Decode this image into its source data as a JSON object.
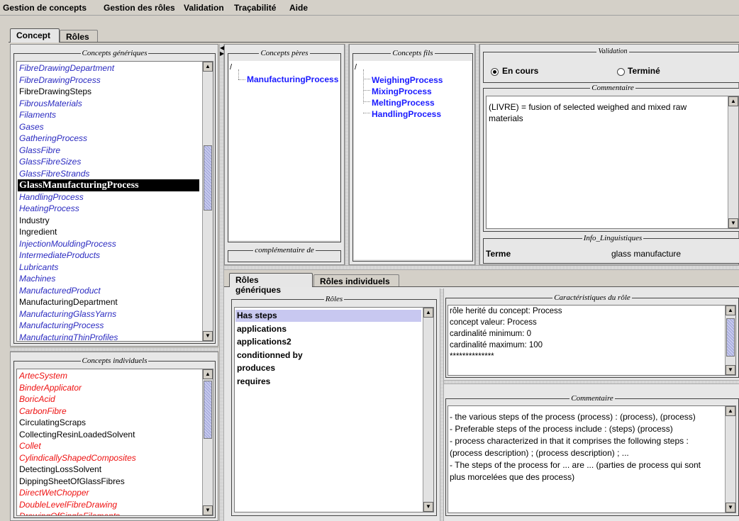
{
  "menu": {
    "items": [
      "Gestion de concepts",
      "Gestion des rôles",
      "Validation",
      "Traçabilité",
      "Aide"
    ]
  },
  "main_tabs": [
    "Concept",
    "Rôles"
  ],
  "generic_concepts": {
    "legend": "Concepts génériques",
    "items": [
      {
        "label": "FibreDrawingDepartment",
        "style": "gen"
      },
      {
        "label": "FibreDrawingProcess",
        "style": "gen"
      },
      {
        "label": "FibreDrawingSteps",
        "style": "blk"
      },
      {
        "label": "FibrousMaterials",
        "style": "gen"
      },
      {
        "label": "Filaments",
        "style": "gen"
      },
      {
        "label": "Gases",
        "style": "gen"
      },
      {
        "label": "GatheringProcess",
        "style": "gen"
      },
      {
        "label": "GlassFibre",
        "style": "gen"
      },
      {
        "label": "GlassFibreSizes",
        "style": "gen"
      },
      {
        "label": "GlassFibreStrands",
        "style": "gen"
      },
      {
        "label": "GlassManufacturingProcess",
        "style": "sel"
      },
      {
        "label": "HandlingProcess",
        "style": "gen"
      },
      {
        "label": "HeatingProcess",
        "style": "gen"
      },
      {
        "label": "Industry",
        "style": "blk"
      },
      {
        "label": "Ingredient",
        "style": "blk"
      },
      {
        "label": "InjectionMouldingProcess",
        "style": "gen"
      },
      {
        "label": "IntermediateProducts",
        "style": "gen"
      },
      {
        "label": "Lubricants",
        "style": "gen"
      },
      {
        "label": "Machines",
        "style": "gen"
      },
      {
        "label": "ManufacturedProduct",
        "style": "gen"
      },
      {
        "label": "ManufacturingDepartment",
        "style": "blk"
      },
      {
        "label": "ManufacturingGlassYarns",
        "style": "gen"
      },
      {
        "label": "ManufacturingProcess",
        "style": "gen"
      },
      {
        "label": "ManufacturingThinProfiles",
        "style": "gen"
      }
    ]
  },
  "individual_concepts": {
    "legend": "Concepts individuels",
    "items": [
      {
        "label": "ArtecSystem",
        "style": "red"
      },
      {
        "label": "BinderApplicator",
        "style": "red"
      },
      {
        "label": "BoricAcid",
        "style": "red"
      },
      {
        "label": "CarbonFibre",
        "style": "red"
      },
      {
        "label": "CirculatingScraps",
        "style": "blk"
      },
      {
        "label": "CollectingResinLoadedSolvent",
        "style": "blk"
      },
      {
        "label": "Collet",
        "style": "red"
      },
      {
        "label": "CylindicallyShapedComposites",
        "style": "red"
      },
      {
        "label": "DetectingLossSolvent",
        "style": "blk"
      },
      {
        "label": "DippingSheetOfGlassFibres",
        "style": "blk"
      },
      {
        "label": "DirectWetChopper",
        "style": "red"
      },
      {
        "label": "DoubleLevelFibreDrawing",
        "style": "red"
      },
      {
        "label": "DrawingOfSingleFilaments",
        "style": "red"
      }
    ]
  },
  "fathers": {
    "legend": "Concepts pères",
    "root": "/",
    "item": "ManufacturingProcess",
    "complement_legend": "complémentaire de"
  },
  "sons": {
    "legend": "Concepts fils",
    "root": "/",
    "items": [
      "WeighingProcess",
      "MixingProcess",
      "MeltingProcess",
      "HandlingProcess"
    ]
  },
  "validation": {
    "legend": "Validation",
    "option_in_progress": "En cours",
    "option_done": "Terminé",
    "selected": "in_progress"
  },
  "comment_top": {
    "legend": "Commentaire",
    "text_line1": "(LIVRE) = fusion of selected weighed and mixed raw",
    "text_line2": "materials"
  },
  "info_ling": {
    "legend": "Info_Linguistiques",
    "term_label": "Terme",
    "term_value": "glass manufacture"
  },
  "role_tabs": [
    "Rôles génériques",
    "Rôles individuels"
  ],
  "roles": {
    "legend": "Rôles",
    "items": [
      "Has steps",
      "applications",
      "applications2",
      "conditionned by",
      "produces",
      "requires"
    ],
    "selected_index": 0
  },
  "role_chars": {
    "legend": "Caractéristiques du rôle",
    "lines": [
      "rôle herité du concept: Process",
      "concept valeur: Process",
      "cardinalité minimum: 0",
      "cardinalité maximum: 100",
      "**************"
    ]
  },
  "role_comment": {
    "legend": "Commentaire",
    "lines": [
      "- the various steps of the process (process) : (process), (process)",
      "- Preferable steps of the process include : (steps) (process)",
      "- process characterized in that it comprises the following steps :",
      "(process description) ;  (process description) ;  ...",
      "- The steps of the process for ... are ... (parties de process qui sont",
      "plus morcelées que des process)"
    ]
  }
}
